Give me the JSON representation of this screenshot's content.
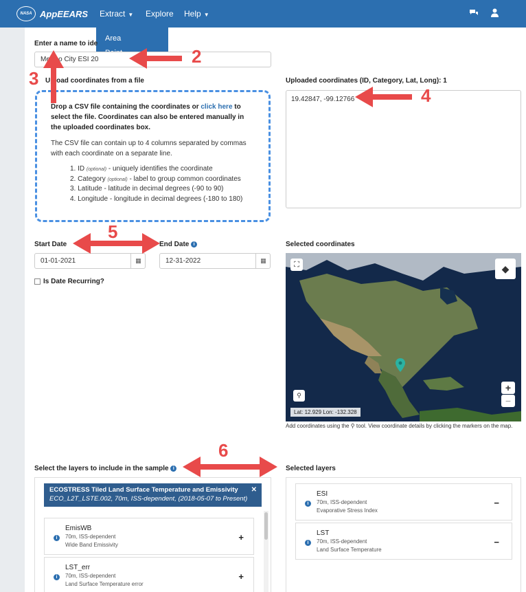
{
  "nav": {
    "brand": "AppEEARS",
    "logo_text": "NASA",
    "extract": "Extract",
    "explore": "Explore",
    "help": "Help",
    "dropdown_items": [
      "Area",
      "Point"
    ]
  },
  "form": {
    "name_label": "Enter a name to ide",
    "name_value": "Mexico City ESI 20",
    "upload_label": "Upload coordinates from a file",
    "upload_label_visible": "Upload coordinates from a file",
    "dropzone": {
      "line1_pre": "Drop a CSV file containing the coordinates or ",
      "line1_link": "click here",
      "line1_post": " to select the file. Coordinates can also be entered manually in the uploaded coordinates box.",
      "paragraph": "The CSV file can contain up to 4 columns separated by commas with each coordinate on a separate line.",
      "items": [
        {
          "num": "1. ID",
          "opt": "(optional)",
          "text": " - uniquely identifies the coordinate"
        },
        {
          "num": "2. Category",
          "opt": "(optional)",
          "text": " - label to group common coordinates"
        },
        {
          "num": "3. Latitude",
          "opt": "",
          "text": " - latitude in decimal degrees (-90 to 90)"
        },
        {
          "num": "4. Longitude",
          "opt": "",
          "text": " - longitude in decimal degrees (-180 to 180)"
        }
      ]
    },
    "uploaded_label": "Uploaded coordinates (ID, Category, Lat, Long): 1",
    "uploaded_value": "19.42847, -99.12766",
    "start_label": "Start Date",
    "start_value": "01-01-2021",
    "end_label": "End Date",
    "end_value": "12-31-2022",
    "recurring_label": "Is Date Recurring?",
    "selected_coords_label": "Selected coordinates",
    "map_coords": "Lat: 12.929 Lon: -132.328",
    "map_note": "Add coordinates using the",
    "map_note_2": "tool. View coordinate details by clicking the markers on the map.",
    "layers_label": "Select the layers to include in the sample",
    "selected_layers_label": "Selected layers"
  },
  "product": {
    "title": "ECOSTRESS Tiled Land Surface Temperature and Emissivity",
    "subtitle": "ECO_L2T_LSTE.002, 70m, ISS-dependent, (2018-05-07 to Present)"
  },
  "available_layers": [
    {
      "name": "EmisWB",
      "res": "70m, ISS-dependent",
      "desc": "Wide Band Emissivity",
      "action": "+"
    },
    {
      "name": "LST_err",
      "res": "70m, ISS-dependent",
      "desc": "Land Surface Temperature error",
      "action": "+"
    }
  ],
  "selected_layers": [
    {
      "name": "ESI",
      "res": "70m, ISS-dependent",
      "desc": "Evaporative Stress Index",
      "action": "−"
    },
    {
      "name": "LST",
      "res": "70m, ISS-dependent",
      "desc": "Land Surface Temperature",
      "action": "−"
    }
  ],
  "annotations": [
    "2",
    "3",
    "4",
    "5",
    "6"
  ],
  "colors": {
    "nav": "#2c6fb0",
    "annotation": "#e84a4a",
    "product_header": "#2f5d8e",
    "marker": "#2bb3a3"
  }
}
